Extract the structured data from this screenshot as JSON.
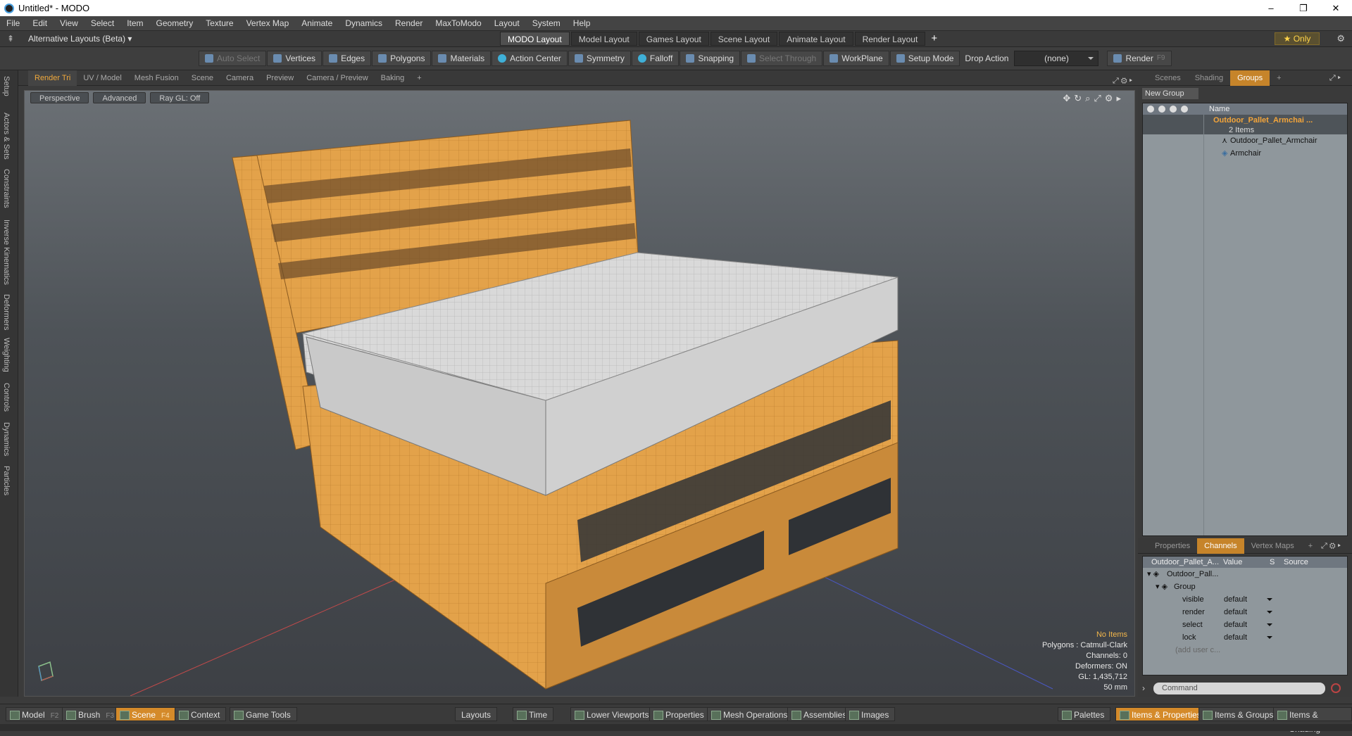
{
  "window": {
    "title": "Untitled* - MODO",
    "min": "–",
    "max": "❐",
    "close": "✕"
  },
  "menu": [
    "File",
    "Edit",
    "View",
    "Select",
    "Item",
    "Geometry",
    "Texture",
    "Vertex Map",
    "Animate",
    "Dynamics",
    "Render",
    "MaxToModo",
    "Layout",
    "System",
    "Help"
  ],
  "layoutbar": {
    "alt": "Alternative Layouts (Beta) ▾",
    "tabs": [
      "MODO Layout",
      "Model Layout",
      "Games Layout",
      "Scene Layout",
      "Animate Layout",
      "Render Layout"
    ],
    "active": 0,
    "plus": "+",
    "only": "★ Only"
  },
  "toolbar": {
    "items": [
      "Auto Select",
      "Vertices",
      "Edges",
      "Polygons",
      "Materials",
      "Action Center",
      "Symmetry",
      "Falloff",
      "Snapping",
      "Select Through",
      "WorkPlane",
      "Setup Mode"
    ],
    "drop_label": "Drop Action",
    "drop_value": "(none)",
    "render": "Render",
    "render_key": "F9"
  },
  "left_tabs": [
    "Setup",
    "Actors & Sets",
    "Constraints",
    "Inverse Kinematics",
    "Deformers",
    "Weighting",
    "Controls",
    "Dynamics",
    "Particles"
  ],
  "viewport_tabs": [
    "Render Tri",
    "UV / Model",
    "Mesh Fusion",
    "Scene",
    "Camera",
    "Preview",
    "Camera / Preview",
    "Baking",
    "+"
  ],
  "viewport": {
    "view": "Perspective",
    "mode": "Advanced",
    "raygl": "Ray GL: Off"
  },
  "stats": {
    "items": "No Items",
    "polygons": "Polygons : Catmull-Clark",
    "channels": "Channels: 0",
    "deformers": "Deformers: ON",
    "gl": "GL: 1,435,712",
    "size": "50 mm"
  },
  "right_tabs": [
    "Scenes",
    "Shading",
    "Groups",
    "+"
  ],
  "groups": {
    "new_group": "New Group",
    "name_col": "Name",
    "group_name": "Outdoor_Pallet_Armchai ...",
    "group_count": "2 Items",
    "children": [
      "Outdoor_Pallet_Armchair",
      "Armchair"
    ]
  },
  "lower_tabs": [
    "Properties",
    "Channels",
    "Vertex Maps",
    "+"
  ],
  "channels": {
    "headers": [
      "Outdoor_Pallet_A...",
      "Value",
      "S",
      "Source"
    ],
    "root": "Outdoor_Pall...",
    "group": "Group",
    "rows": [
      {
        "name": "visible",
        "value": "default"
      },
      {
        "name": "render",
        "value": "default"
      },
      {
        "name": "select",
        "value": "default"
      },
      {
        "name": "lock",
        "value": "default"
      }
    ],
    "add": "(add user c..."
  },
  "command": {
    "placeholder": "Command"
  },
  "bottom": {
    "left": [
      {
        "label": "Model",
        "key": "F2"
      },
      {
        "label": "Brush",
        "key": "F3"
      },
      {
        "label": "Scene",
        "key": "F4"
      },
      {
        "label": "Context",
        "key": ""
      },
      {
        "label": "Game Tools",
        "key": ""
      }
    ],
    "center": [
      "Layouts",
      "Time",
      "Lower Viewports",
      "Properties",
      "Mesh Operations",
      "Assemblies",
      "Images"
    ],
    "right": [
      "Palettes",
      "Items & Properties",
      "Items & Groups",
      "Items & Shading"
    ]
  },
  "colors": {
    "accent": "#d48a2a",
    "selected_text": "#f4a53a",
    "wood": "#e3a24a",
    "cushion": "#d8d8d8"
  }
}
